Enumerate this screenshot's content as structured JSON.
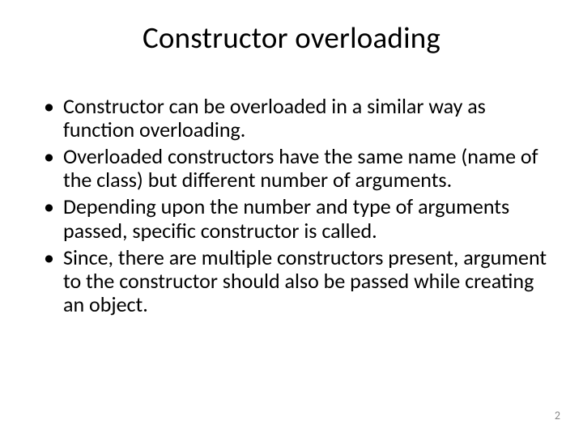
{
  "slide": {
    "title": "Constructor overloading",
    "bullets": [
      "Constructor can be overloaded in a similar way as function overloading.",
      "Overloaded constructors have the same name (name of the class) but different number of arguments.",
      "Depending upon the number and type of arguments passed, specific constructor is called.",
      "Since, there are multiple constructors present, argument to the constructor should also be passed while creating an object."
    ],
    "page_number": "2"
  }
}
